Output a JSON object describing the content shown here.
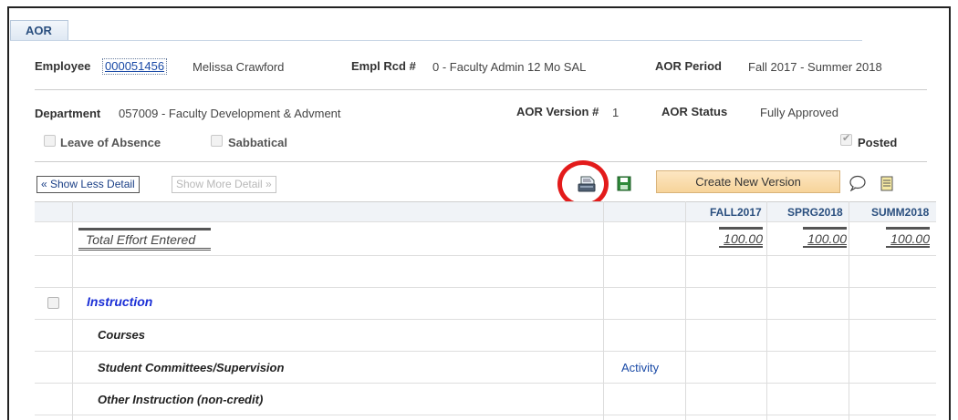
{
  "tab": {
    "label": "AOR"
  },
  "header": {
    "employee_label": "Employee",
    "employee_id": "000051456",
    "employee_name": "Melissa Crawford",
    "empl_rcd_label": "Empl Rcd #",
    "empl_rcd_value": "0 - Faculty Admin 12 Mo SAL",
    "aor_period_label": "AOR Period",
    "aor_period_value": "Fall 2017 - Summer 2018",
    "department_label": "Department",
    "department_value": "057009 - Faculty Development & Advment",
    "aor_version_label": "AOR Version #",
    "aor_version_value": "1",
    "aor_status_label": "AOR Status",
    "aor_status_value": "Fully Approved"
  },
  "checkboxes": {
    "leave_label": "Leave of Absence",
    "leave_checked": false,
    "sabbatical_label": "Sabbatical",
    "sabbatical_checked": false,
    "posted_label": "Posted",
    "posted_checked": true
  },
  "toolbar": {
    "show_less_label": "« Show Less Detail",
    "show_more_label": "Show More Detail »",
    "create_version_label": "Create New Version",
    "print_icon": "print-icon",
    "save_icon": "save-icon",
    "comment_icon": "comment-icon",
    "notes_icon": "notes-icon",
    "highlight_color": "#e31b1b"
  },
  "grid": {
    "columns": [
      "FALL2017",
      "SPRG2018",
      "SUMM2018"
    ],
    "total_label": "Total Effort Entered",
    "totals": [
      "100.00",
      "100.00",
      "100.00"
    ],
    "section_label": "Instruction",
    "rows": [
      {
        "label": "Courses",
        "link": ""
      },
      {
        "label": "Student Committees/Supervision",
        "link": "Activity"
      },
      {
        "label": "Other Instruction (non-credit)",
        "link": ""
      }
    ]
  }
}
